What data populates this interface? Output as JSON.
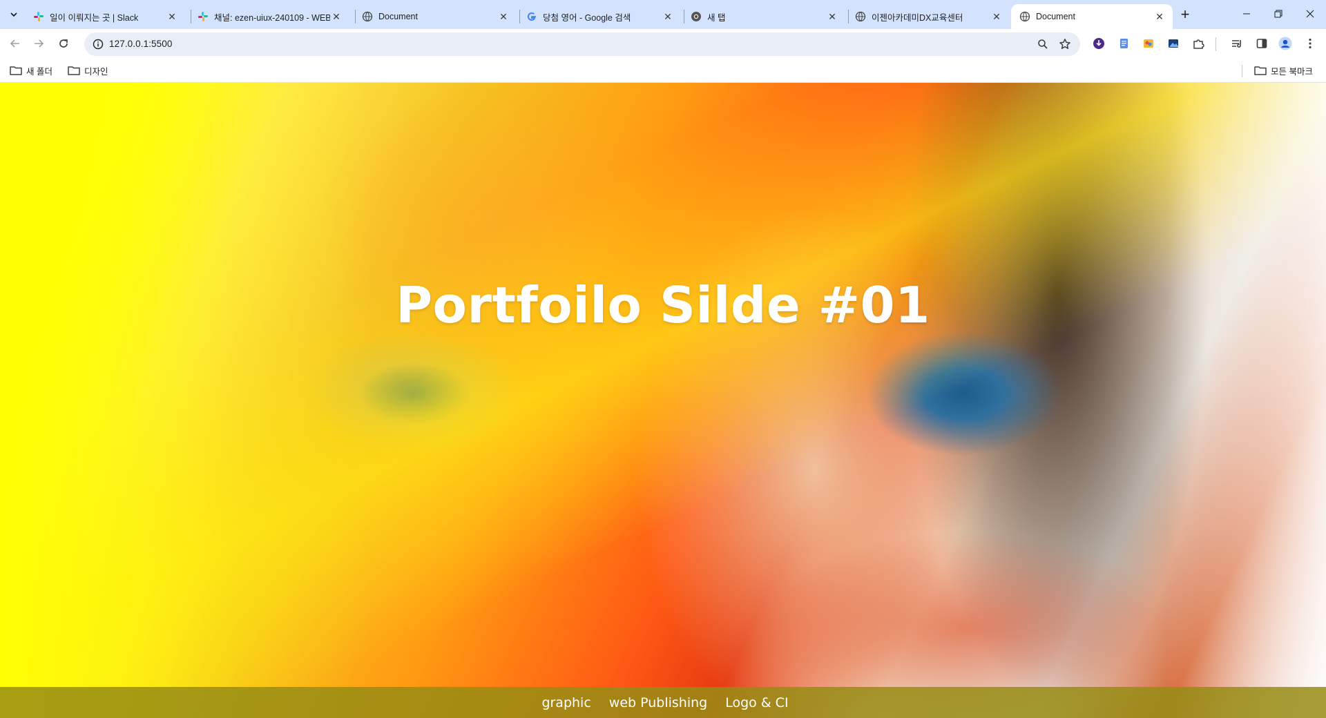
{
  "browser": {
    "tabs": [
      {
        "title": "일이 이뤄지는 곳 | Slack",
        "favicon": "slack-icon"
      },
      {
        "title": "채널: ezen-uiux-240109 - WEB",
        "favicon": "slack-icon"
      },
      {
        "title": "Document",
        "favicon": "globe-icon"
      },
      {
        "title": "당첨 영어 - Google 검색",
        "favicon": "google-icon"
      },
      {
        "title": "새 탭",
        "favicon": "chrome-icon"
      },
      {
        "title": "이젠아카데미DX교육센터",
        "favicon": "globe-icon"
      },
      {
        "title": "Document",
        "favicon": "globe-icon",
        "active": true
      }
    ],
    "address": {
      "url": "127.0.0.1:5500"
    },
    "bookmarks": [
      {
        "label": "새 폴더",
        "icon": "folder-icon"
      },
      {
        "label": "디자인",
        "icon": "folder-icon"
      }
    ],
    "all_bookmarks_label": "모든 북마크"
  },
  "page": {
    "hero_title": "Portfoilo Silde #01",
    "nav": [
      {
        "label": "graphic"
      },
      {
        "label": "web Publishing"
      },
      {
        "label": "Logo & CI"
      }
    ]
  },
  "colors": {
    "tabstrip": "#d3e3fd",
    "footer_bar": "#969614",
    "hero_text": "#ffffff"
  }
}
